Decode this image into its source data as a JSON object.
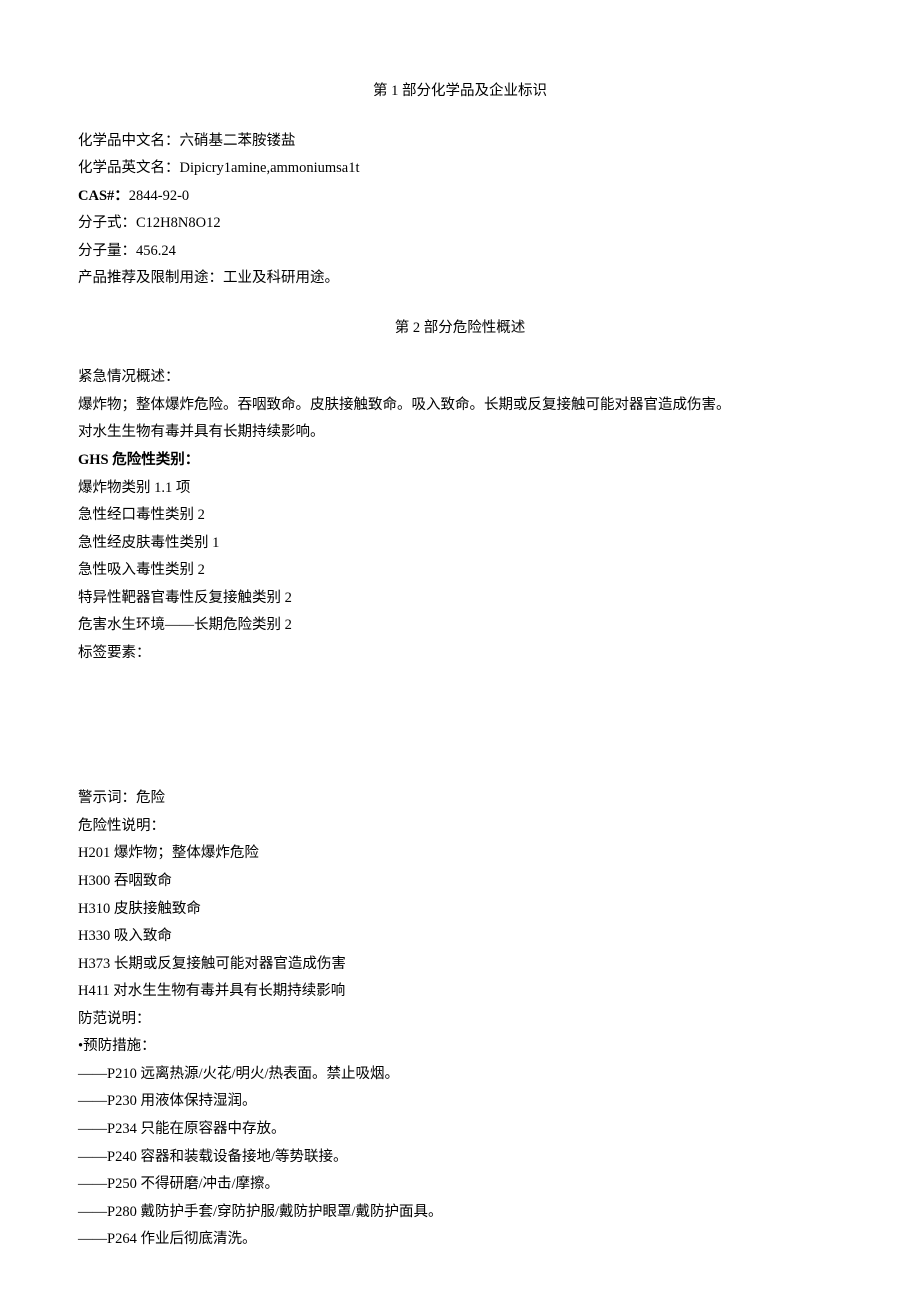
{
  "section1": {
    "title": "第 1 部分化学品及企业标识",
    "name_cn_label": "化学品中文名：",
    "name_cn": "六硝基二苯胺镂盐",
    "name_en_label": "化学品英文名：",
    "name_en": "Dipicry1amine,ammoniumsa1t",
    "cas_label": "CAS#：",
    "cas": "2844-92-0",
    "formula_label": "分子式：",
    "formula": "C12H8N8O12",
    "mw_label": "分子量：",
    "mw": "456.24",
    "use_label": "产品推荐及限制用途：",
    "use": "工业及科研用途。"
  },
  "section2": {
    "title": "第 2 部分危险性概述",
    "emergency_label": "紧急情况概述：",
    "emergency1": "爆炸物；整体爆炸危险。吞咽致命。皮肤接触致命。吸入致命。长期或反复接触可能对器官造成伤害。",
    "emergency2": "对水生生物有毒并具有长期持续影响。",
    "ghs_label": "GHS 危险性类别：",
    "ghs": [
      "爆炸物类别 1.1 项",
      "急性经口毒性类别 2",
      "急性经皮肤毒性类别 1",
      "急性吸入毒性类别 2",
      "特异性靶器官毒性反复接触类别 2",
      "危害水生环境——长期危险类别 2"
    ],
    "label_elements": "标签要素：",
    "signal_word_label": "警示词：",
    "signal_word": "危险",
    "hazard_label": "危险性说明：",
    "hazard": [
      "H201 爆炸物；整体爆炸危险",
      "H300 吞咽致命",
      "H310 皮肤接触致命",
      "H330 吸入致命",
      "H373 长期或反复接触可能对器官造成伤害",
      "H411 对水生生物有毒并具有长期持续影响"
    ],
    "precaution_label": "防范说明：",
    "prevention_label": "•预防措施：",
    "prevention": [
      "——P210 远离热源/火花/明火/热表面。禁止吸烟。",
      "——P230 用液体保持湿润。",
      "——P234 只能在原容器中存放。",
      "——P240 容器和装载设备接地/等势联接。",
      "——P250 不得研磨/冲击/摩擦。",
      "——P280 戴防护手套/穿防护服/戴防护眼罩/戴防护面具。",
      "——P264 作业后彻底清洗。"
    ]
  }
}
